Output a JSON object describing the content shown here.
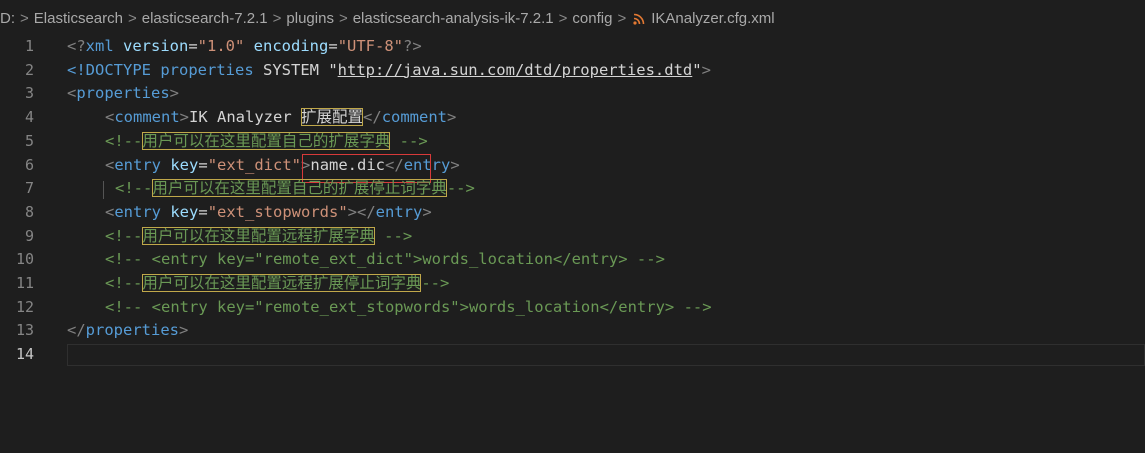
{
  "breadcrumb": {
    "items": [
      "D:",
      "Elasticsearch",
      "elasticsearch-7.2.1",
      "plugins",
      "elasticsearch-analysis-ik-7.2.1",
      "config"
    ],
    "file": "IKAnalyzer.cfg.xml",
    "file_icon": "rss-xml-icon",
    "separator": ">"
  },
  "editor": {
    "line_numbers": [
      "1",
      "2",
      "3",
      "4",
      "5",
      "6",
      "7",
      "8",
      "9",
      "10",
      "11",
      "12",
      "13",
      "14"
    ],
    "active_line": "14",
    "lines": {
      "l1": {
        "a": "<?",
        "b": "xml",
        "c": " version",
        "d": "=",
        "e": "\"1.0\"",
        "f": " encoding",
        "g": "=",
        "h": "\"UTF-8\"",
        "i": "?>"
      },
      "l2": {
        "a": "<!DOCTYPE ",
        "b": "properties",
        "c": " SYSTEM ",
        "d": "\"",
        "e": "http://java.sun.com/dtd/properties.dtd",
        "f": "\"",
        "g": ">"
      },
      "l3": {
        "a": "<",
        "b": "properties",
        "c": ">"
      },
      "l4": {
        "a": "<",
        "b": "comment",
        "c": ">",
        "d": "IK Analyzer ",
        "e": "扩展配置",
        "f": "</",
        "g": "comment",
        "h": ">"
      },
      "l5": {
        "a": "<!--",
        "b": "用户可以在这里配置自己的扩展字典",
        "c": " -->"
      },
      "l6": {
        "a": "<",
        "b": "entry",
        "c": " key",
        "d": "=",
        "e": "\"ext_dict\"",
        "f": ">",
        "g": "name.dic",
        "h": "</",
        "i": "entry",
        "j": ">"
      },
      "l7": {
        "a": "<!--",
        "b": "用户可以在这里配置自己的扩展停止词字典",
        "c": "-->"
      },
      "l8": {
        "a": "<",
        "b": "entry",
        "c": " key",
        "d": "=",
        "e": "\"ext_stopwords\"",
        "f": "></",
        "g": "entry",
        "h": ">"
      },
      "l9": {
        "a": "<!--",
        "b": "用户可以在这里配置远程扩展字典",
        "c": " -->"
      },
      "l10": {
        "a": "<!-- <entry key=\"remote_ext_dict\">words_location</entry> -->"
      },
      "l11": {
        "a": "<!--",
        "b": "用户可以在这里配置远程扩展停止词字典",
        "c": "-->"
      },
      "l12": {
        "a": "<!-- <entry key=\"remote_ext_stopwords\">words_location</entry> -->"
      },
      "l13": {
        "a": "</",
        "b": "properties",
        "c": ">"
      },
      "l14": {
        "a": ""
      }
    }
  }
}
